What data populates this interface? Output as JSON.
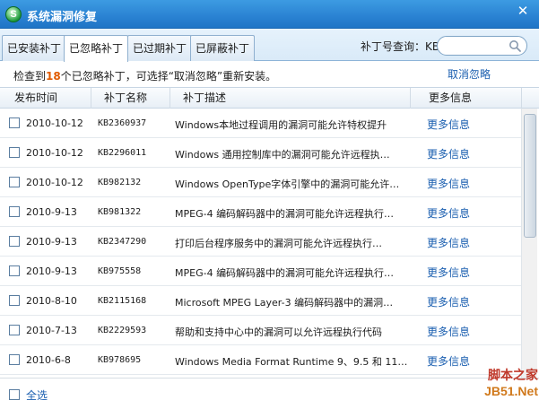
{
  "window": {
    "title": "系统漏洞修复",
    "app_icon_letter": "S",
    "close_glyph": "✕"
  },
  "tabs": [
    {
      "label": "已安装补丁",
      "active": false
    },
    {
      "label": "已忽略补丁",
      "active": true
    },
    {
      "label": "已过期补丁",
      "active": false
    },
    {
      "label": "已屏蔽补丁",
      "active": false
    }
  ],
  "search": {
    "label": "补丁号查询：KB",
    "value": "",
    "placeholder": "",
    "icon": "search-icon"
  },
  "info": {
    "prefix": "检查到",
    "count": "18",
    "suffix": "个已忽略补丁，可选择“取消忽略”重新安装。",
    "action_label": "取消忽略"
  },
  "table": {
    "headers": [
      "发布时间",
      "补丁名称",
      "补丁描述",
      "更多信息"
    ],
    "rows": [
      {
        "date": "2010-10-12",
        "kb": "KB2360937",
        "desc": "Windows本地过程调用的漏洞可能允许特权提升",
        "more": "更多信息"
      },
      {
        "date": "2010-10-12",
        "kb": "KB2296011",
        "desc": "Windows 通用控制库中的漏洞可能允许远程执…",
        "more": "更多信息"
      },
      {
        "date": "2010-10-12",
        "kb": "KB982132",
        "desc": "Windows OpenType字体引擎中的漏洞可能允许…",
        "more": "更多信息"
      },
      {
        "date": "2010-9-13",
        "kb": "KB981322",
        "desc": "MPEG-4 编码解码器中的漏洞可能允许远程执行…",
        "more": "更多信息"
      },
      {
        "date": "2010-9-13",
        "kb": "KB2347290",
        "desc": "打印后台程序服务中的漏洞可能允许远程执行…",
        "more": "更多信息"
      },
      {
        "date": "2010-9-13",
        "kb": "KB975558",
        "desc": "MPEG-4 编码解码器中的漏洞可能允许远程执行…",
        "more": "更多信息"
      },
      {
        "date": "2010-8-10",
        "kb": "KB2115168",
        "desc": "Microsoft MPEG Layer-3 编码解码器中的漏洞…",
        "more": "更多信息"
      },
      {
        "date": "2010-7-13",
        "kb": "KB2229593",
        "desc": "帮助和支持中心中的漏洞可以允许远程执行代码",
        "more": "更多信息"
      },
      {
        "date": "2010-6-8",
        "kb": "KB978695",
        "desc": "Windows Media Format Runtime 9、9.5 和 11…",
        "more": "更多信息"
      }
    ]
  },
  "footer": {
    "select_all_label": "全选"
  },
  "watermark": {
    "top": "脚本之家",
    "bottom": "JB51.Net"
  },
  "colors": {
    "titlebar": "#2a82d2",
    "link": "#1b5fb0",
    "count": "#e05a00"
  }
}
